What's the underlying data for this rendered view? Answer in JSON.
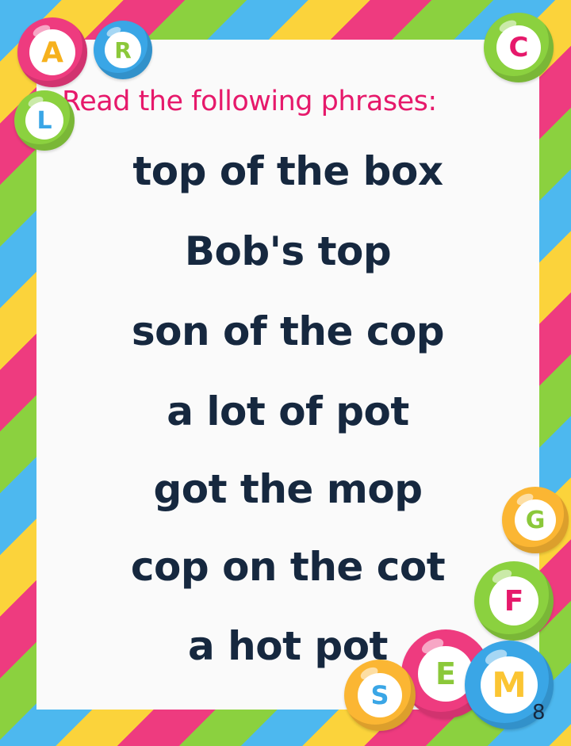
{
  "worksheet": {
    "heading": "Read the following phrases:",
    "phrases": [
      "top of the box",
      "Bob's top",
      "son of the cop",
      "a lot of pot",
      "got the mop",
      "cop on the cot",
      "a hot pot"
    ],
    "page_number": "8"
  },
  "decorations": {
    "letter_bubbles": [
      {
        "letter": "A",
        "color": "#ee3b7f",
        "letter_color": "#f6b11d"
      },
      {
        "letter": "R",
        "color": "#3aa6e6",
        "letter_color": "#8bc83a"
      },
      {
        "letter": "L",
        "color": "#8bd13f",
        "letter_color": "#3aa6e6"
      },
      {
        "letter": "C",
        "color": "#8bd13f",
        "letter_color": "#e6196b"
      },
      {
        "letter": "G",
        "color": "#fbb633",
        "letter_color": "#8bc83a"
      },
      {
        "letter": "F",
        "color": "#8bd13f",
        "letter_color": "#e6196b"
      },
      {
        "letter": "E",
        "color": "#ee3b7f",
        "letter_color": "#8bc83a"
      },
      {
        "letter": "S",
        "color": "#fbb633",
        "letter_color": "#3aa6e6"
      },
      {
        "letter": "M",
        "color": "#3aa6e6",
        "letter_color": "#fbc533"
      }
    ],
    "stripe_colors": [
      "#4db8ef",
      "#fbd33b",
      "#ee3b7f",
      "#8bd13f"
    ],
    "text_color": "#16283f",
    "heading_color": "#e6196b"
  }
}
